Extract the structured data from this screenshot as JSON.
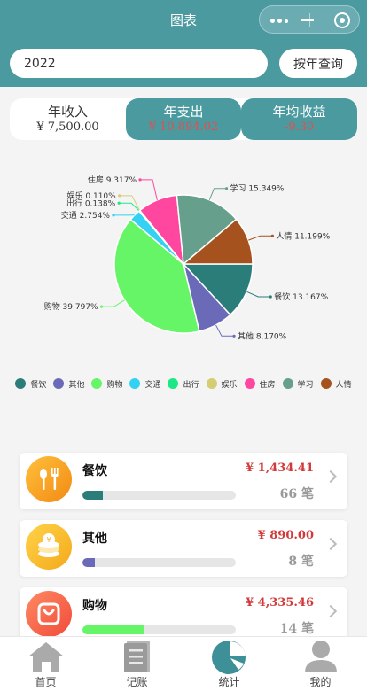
{
  "window": {
    "title": "图表"
  },
  "search": {
    "year_value": "2022",
    "query_label": "按年查询"
  },
  "summary": [
    {
      "label": "年收入",
      "value": "¥ 7,500.00"
    },
    {
      "label": "年支出",
      "value": "¥ 10,894.02"
    },
    {
      "label": "年均收益",
      "value": "-9.30"
    }
  ],
  "chart_data": {
    "type": "pie",
    "slices": [
      {
        "name": "餐饮",
        "percent": 13.167,
        "label": "餐饮 13.167%",
        "color": "#2a7d78"
      },
      {
        "name": "其他",
        "percent": 8.17,
        "label": "其他 8.170%",
        "color": "#6a6ab8"
      },
      {
        "name": "购物",
        "percent": 39.797,
        "label": "购物 39.797%",
        "color": "#66f566"
      },
      {
        "name": "交通",
        "percent": 2.754,
        "label": "交通 2.754%",
        "color": "#33d1f2"
      },
      {
        "name": "出行",
        "percent": 0.138,
        "label": "出行 0.138%",
        "color": "#1ee886"
      },
      {
        "name": "娱乐",
        "percent": 0.11,
        "label": "娱乐 0.110%",
        "color": "#d6cc72"
      },
      {
        "name": "住房",
        "percent": 9.317,
        "label": "住房 9.317%",
        "color": "#ff479f"
      },
      {
        "name": "学习",
        "percent": 15.349,
        "label": "学习 15.349%",
        "color": "#66a08c"
      },
      {
        "name": "人情",
        "percent": 11.199,
        "label": "人情 11.199%",
        "color": "#a5521e"
      }
    ],
    "legend": "bottom"
  },
  "categories": [
    {
      "name": "餐饮",
      "amount": "¥ 1,434.41",
      "count": "66 笔",
      "progress": 0.132,
      "bar_color": "#2a7d78",
      "icon": "fork-knife-icon",
      "icon_color": "#f6a31d"
    },
    {
      "name": "其他",
      "amount": "¥ 890.00",
      "count": "8 笔",
      "progress": 0.082,
      "bar_color": "#6a6ab8",
      "icon": "coin-stack-icon",
      "icon_color": "#f7b71c"
    },
    {
      "name": "购物",
      "amount": "¥ 4,335.46",
      "count": "14 笔",
      "progress": 0.398,
      "bar_color": "#66f566",
      "icon": "shopping-bag-icon",
      "icon_color": "#f5674c"
    }
  ],
  "tabbar": [
    {
      "label": "首页",
      "icon": "home-icon"
    },
    {
      "label": "记账",
      "icon": "notebook-icon"
    },
    {
      "label": "统计",
      "icon": "pie-chart-icon"
    },
    {
      "label": "我的",
      "icon": "user-icon"
    }
  ],
  "colors": {
    "header": "#4a9aa0",
    "active_tab": "#4a9aa0",
    "expense": "#d23a3a"
  }
}
